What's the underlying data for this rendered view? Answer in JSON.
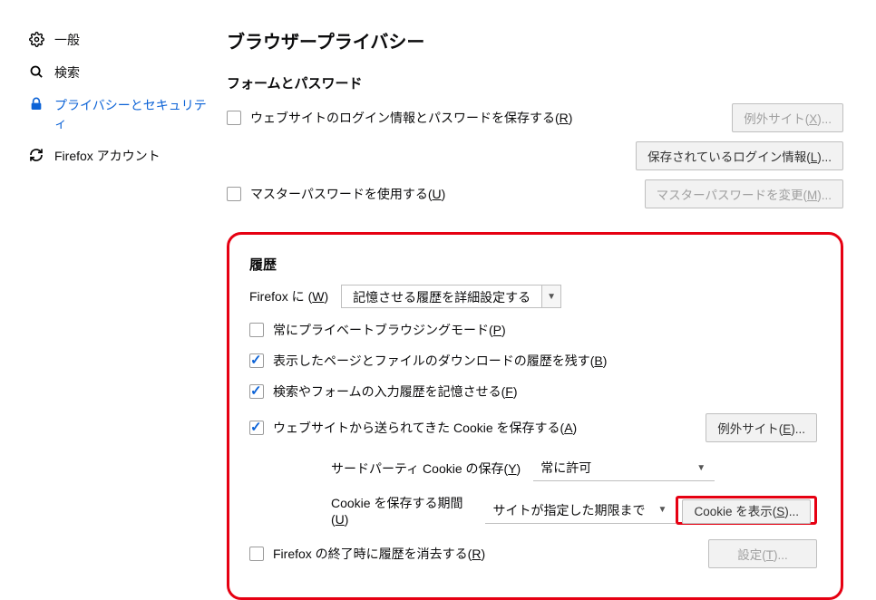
{
  "sidebar": {
    "items": [
      {
        "label": "一般"
      },
      {
        "label": "検索"
      },
      {
        "label": "プライバシーとセキュリティ"
      },
      {
        "label": "Firefox アカウント"
      }
    ]
  },
  "section_title": "ブラウザープライバシー",
  "forms": {
    "title": "フォームとパスワード",
    "save_logins_label": "ウェブサイトのログイン情報とパスワードを保存する(",
    "save_logins_key": "R",
    "btn_exceptions": "例外サイト(",
    "btn_exceptions_key": "X",
    "btn_saved_logins": "保存されているログイン情報(",
    "btn_saved_logins_key": "L",
    "master_pw_label": "マスターパスワードを使用する(",
    "master_pw_key": "U",
    "btn_change_master": "マスターパスワードを変更(",
    "btn_change_master_key": "M"
  },
  "history": {
    "title": "履歴",
    "firefox_will_prefix": "Firefox に (",
    "firefox_will_key": "W",
    "firefox_will_suffix": ")",
    "select_value": "記憶させる履歴を詳細設定する",
    "private_mode_label": "常にプライベートブラウジングモード(",
    "private_mode_key": "P",
    "remember_browsing_label": "表示したページとファイルのダウンロードの履歴を残す(",
    "remember_browsing_key": "B",
    "remember_forms_label": "検索やフォームの入力履歴を記憶させる(",
    "remember_forms_key": "F",
    "accept_cookies_label": "ウェブサイトから送られてきた Cookie を保存する(",
    "accept_cookies_key": "A",
    "btn_cookie_exceptions": "例外サイト(",
    "btn_cookie_exceptions_key": "E",
    "third_party_label": "サードパーティ Cookie の保存(",
    "third_party_key": "Y",
    "third_party_value": "常に許可",
    "keep_until_label": "Cookie を保存する期間(",
    "keep_until_key": "U",
    "keep_until_value": "サイトが指定した期限まで",
    "btn_show_cookies": "Cookie を表示(",
    "btn_show_cookies_key": "S",
    "clear_on_close_label": "Firefox の終了時に履歴を消去する(",
    "clear_on_close_key": "R",
    "btn_settings": "設定(",
    "btn_settings_key": "T"
  }
}
